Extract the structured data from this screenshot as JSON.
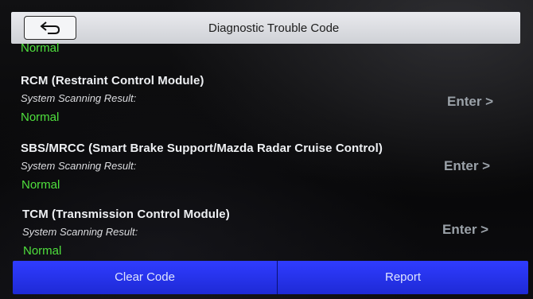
{
  "header": {
    "title": "Diagnostic Trouble Code"
  },
  "partial_row": {
    "status": "Normal"
  },
  "modules": [
    {
      "name": "RCM (Restraint Control Module)",
      "result_label": "System Scanning Result:",
      "status": "Normal",
      "action": "Enter >"
    },
    {
      "name": "SBS/MRCC (Smart Brake Support/Mazda Radar Cruise Control)",
      "result_label": "System Scanning Result:",
      "status": "Normal",
      "action": "Enter >"
    },
    {
      "name": "TCM (Transmission Control Module)",
      "result_label": "System Scanning Result:",
      "status": "Normal",
      "action": "Enter >"
    }
  ],
  "footer": {
    "clear_label": "Clear Code",
    "report_label": "Report"
  },
  "colors": {
    "status_ok": "#4fe03d",
    "button_bar": "#2633e6",
    "header_bg": "#dcdee2"
  }
}
